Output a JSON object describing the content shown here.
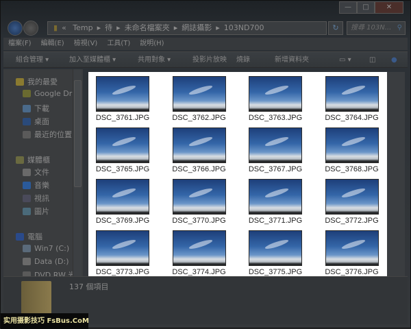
{
  "window": {
    "buttons": [
      "minimize",
      "maximize",
      "close"
    ]
  },
  "address": {
    "prefix": "«",
    "crumbs": [
      "Temp",
      "待",
      "未命名檔案夾",
      "網誌攝影",
      "103ND700"
    ],
    "search_placeholder": "搜尋 103N..."
  },
  "menu": [
    "檔案(F)",
    "編輯(E)",
    "檢視(V)",
    "工具(T)",
    "說明(H)"
  ],
  "toolbar": [
    "組合管理 ▾",
    "加入至媒體櫃 ▾",
    "共用對象 ▾",
    "投影片放映",
    "燒錄",
    "新增資料夾"
  ],
  "nav": [
    {
      "label": "我的最愛",
      "icon": "star-icon",
      "color": "#8a7a30",
      "level": 0
    },
    {
      "label": "Google Dri",
      "icon": "google-drive-icon",
      "color": "#6a6a30",
      "level": 1
    },
    {
      "label": "下載",
      "icon": "downloads-icon",
      "color": "#4a6a8a",
      "level": 1
    },
    {
      "label": "桌面",
      "icon": "desktop-icon",
      "color": "#2a4a7a",
      "level": 1
    },
    {
      "label": "最近的位置",
      "icon": "recent-places-icon",
      "color": "#5a5a5a",
      "level": 1
    },
    {
      "label": "媒體櫃",
      "icon": "libraries-icon",
      "color": "#6a6a40",
      "level": 0
    },
    {
      "label": "文件",
      "icon": "documents-icon",
      "color": "#6a6a6a",
      "level": 1
    },
    {
      "label": "音樂",
      "icon": "music-icon",
      "color": "#2a5a9a",
      "level": 1
    },
    {
      "label": "視訊",
      "icon": "videos-icon",
      "color": "#4a4a5a",
      "level": 1
    },
    {
      "label": "圖片",
      "icon": "pictures-icon",
      "color": "#4a6a7a",
      "level": 1
    },
    {
      "label": "電腦",
      "icon": "computer-icon",
      "color": "#2a4a8a",
      "level": 0
    },
    {
      "label": "Win7 (C:)",
      "icon": "drive-c-icon",
      "color": "#5a6a7a",
      "level": 1
    },
    {
      "label": "Data (D:)",
      "icon": "drive-d-icon",
      "color": "#6a6a6a",
      "level": 1
    },
    {
      "label": "DVD RW 光",
      "icon": "dvd-drive-icon",
      "color": "#5a5a5a",
      "level": 1
    }
  ],
  "files": [
    "DSC_3761.JPG",
    "DSC_3762.JPG",
    "DSC_3763.JPG",
    "DSC_3764.JPG",
    "DSC_3765.JPG",
    "DSC_3766.JPG",
    "DSC_3767.JPG",
    "DSC_3768.JPG",
    "DSC_3769.JPG",
    "DSC_3770.JPG",
    "DSC_3771.JPG",
    "DSC_3772.JPG",
    "DSC_3773.JPG",
    "DSC_3774.JPG",
    "DSC_3775.JPG",
    "DSC_3776.JPG"
  ],
  "details": {
    "count": "137 個項目"
  },
  "watermark": "实用摄影技巧 FsBus.CoM"
}
